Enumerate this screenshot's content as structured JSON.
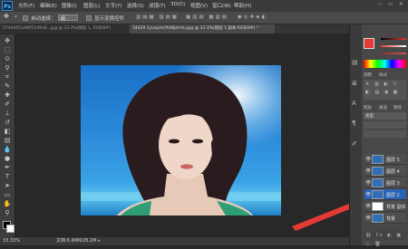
{
  "app": {
    "logo": "Ps"
  },
  "menu": [
    "文件(F)",
    "编辑(E)",
    "图像(I)",
    "图层(L)",
    "文字(Y)",
    "选择(S)",
    "滤镜(T)",
    "3D(D)",
    "视图(V)",
    "窗口(W)",
    "帮助(H)"
  ],
  "options": {
    "auto_select_label": "自动选择：",
    "auto_select_value": "组",
    "show_transform_label": "显示变换控件"
  },
  "tabs": [
    {
      "label": "5744e5f1a96f53d9d4...jpg @ 33.3%(图层 1, RGB/8#)"
    },
    {
      "label": "34429 1yuepmrfhd8ptrHu.jpg @ 33.3%(图层 1 副本 RGB/8#) *"
    }
  ],
  "status": {
    "zoom": "33.33%",
    "doc": "文档:6.49M/28.2M"
  },
  "right_tabs": {
    "adjust": "调整",
    "style": "样式",
    "layers": "图层",
    "channels": "通道",
    "paths": "路径",
    "kind": "类型"
  },
  "layers": [
    {
      "name": "图层 5"
    },
    {
      "name": "图层 4"
    },
    {
      "name": "图层 3"
    },
    {
      "name": "图层 2"
    },
    {
      "name": "背景 副本"
    },
    {
      "name": "背景"
    }
  ],
  "colors": {
    "accent": "#e53935",
    "selected_layer": "#2a63b5",
    "photo_sky": "#2b89d9"
  },
  "icons": [
    "move-icon",
    "marquee-icon",
    "lasso-icon",
    "magic-wand-icon",
    "crop-icon",
    "eyedropper-icon",
    "healing-icon",
    "brush-icon",
    "stamp-icon",
    "history-brush-icon",
    "eraser-icon",
    "gradient-icon",
    "blur-icon",
    "dodge-icon",
    "pen-icon",
    "type-icon",
    "path-select-icon",
    "shape-icon",
    "hand-icon",
    "zoom-icon"
  ]
}
